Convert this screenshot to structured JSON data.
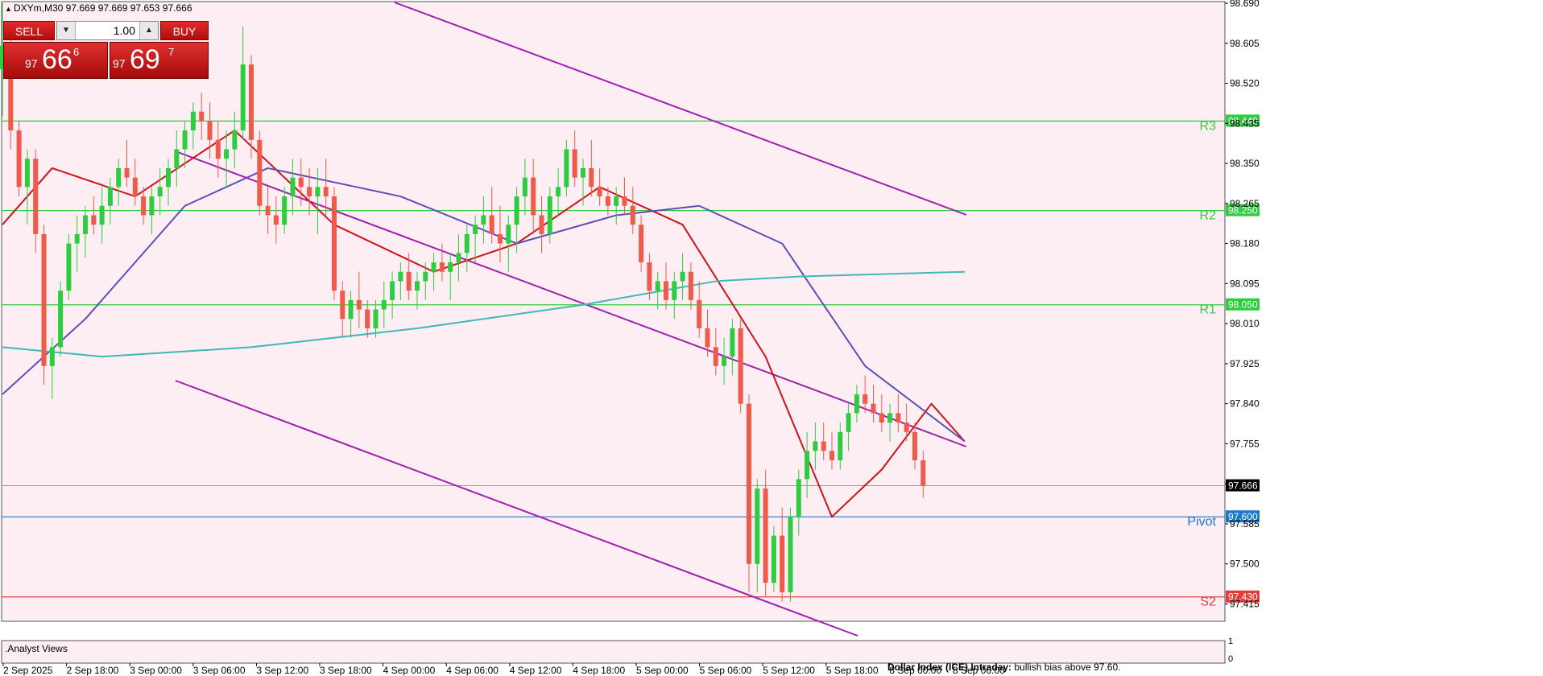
{
  "header": {
    "symbol_line": "DXYm,M30  97.669 97.669 97.653 97.666"
  },
  "trade_panel": {
    "sell_label": "SELL",
    "buy_label": "BUY",
    "lot_value": "1.00",
    "sell_price": {
      "prefix": "97",
      "big": "66",
      "sup": "6"
    },
    "buy_price": {
      "prefix": "97",
      "big": "69",
      "sup": "7"
    }
  },
  "indicator_window": {
    "label": ".Analyst Views",
    "scale_top": "1",
    "scale_bottom": "0",
    "note_bold": "Dollar Index (ICE) Intraday:",
    "note_text": " bullish bias above 97.60."
  },
  "chart_data": {
    "type": "candlestick",
    "symbol": "DXYm",
    "timeframe": "M30",
    "ylim": [
      97.38,
      98.69
    ],
    "y_ticks": [
      "98.690",
      "98.605",
      "98.520",
      "98.435",
      "98.350",
      "98.265",
      "98.180",
      "98.095",
      "98.010",
      "97.925",
      "97.840",
      "97.755",
      "97.670",
      "97.585",
      "97.500",
      "97.415"
    ],
    "x_ticks": [
      "2 Sep 2025",
      "2 Sep 18:00",
      "3 Sep 00:00",
      "3 Sep 06:00",
      "3 Sep 12:00",
      "3 Sep 18:00",
      "4 Sep 00:00",
      "4 Sep 06:00",
      "4 Sep 12:00",
      "4 Sep 18:00",
      "5 Sep 00:00",
      "5 Sep 06:00",
      "5 Sep 12:00",
      "5 Sep 18:00",
      "8 Sep 00:00",
      "8 Sep 06:00"
    ],
    "current_price": 97.666,
    "current_price_label": "97.666",
    "levels": [
      {
        "name": "R3",
        "value": 98.44,
        "label": "98.440",
        "color": "#2ecc40"
      },
      {
        "name": "R2",
        "value": 98.25,
        "label": "98.250",
        "color": "#2ecc40"
      },
      {
        "name": "R1",
        "value": 98.05,
        "label": "98.050",
        "color": "#2ecc40"
      },
      {
        "name": "Pivot",
        "value": 97.6,
        "label": "97.600",
        "color": "#1e78c8"
      },
      {
        "name": "S2",
        "value": 97.43,
        "label": "97.430",
        "color": "#e03c3c"
      }
    ],
    "candles": [
      [
        98.55,
        98.69,
        98.45,
        98.6
      ],
      [
        98.6,
        98.62,
        98.38,
        98.42
      ],
      [
        98.42,
        98.44,
        98.28,
        98.3
      ],
      [
        98.3,
        98.38,
        98.22,
        98.36
      ],
      [
        98.36,
        98.38,
        98.16,
        98.2
      ],
      [
        98.2,
        98.22,
        97.88,
        97.92
      ],
      [
        97.92,
        97.98,
        97.85,
        97.96
      ],
      [
        97.96,
        98.1,
        97.94,
        98.08
      ],
      [
        98.08,
        98.2,
        98.06,
        98.18
      ],
      [
        98.18,
        98.24,
        98.12,
        98.2
      ],
      [
        98.2,
        98.26,
        98.15,
        98.24
      ],
      [
        98.24,
        98.28,
        98.2,
        98.22
      ],
      [
        98.22,
        98.3,
        98.18,
        98.26
      ],
      [
        98.26,
        98.32,
        98.22,
        98.3
      ],
      [
        98.3,
        98.36,
        98.26,
        98.34
      ],
      [
        98.34,
        98.4,
        98.3,
        98.32
      ],
      [
        98.32,
        98.36,
        98.26,
        98.28
      ],
      [
        98.28,
        98.3,
        98.22,
        98.24
      ],
      [
        98.24,
        98.3,
        98.2,
        98.28
      ],
      [
        98.28,
        98.34,
        98.24,
        98.3
      ],
      [
        98.3,
        98.36,
        98.26,
        98.34
      ],
      [
        98.34,
        98.42,
        98.3,
        98.38
      ],
      [
        98.38,
        98.44,
        98.34,
        98.42
      ],
      [
        98.42,
        98.48,
        98.38,
        98.46
      ],
      [
        98.46,
        98.5,
        98.4,
        98.44
      ],
      [
        98.44,
        98.48,
        98.36,
        98.4
      ],
      [
        98.4,
        98.44,
        98.32,
        98.36
      ],
      [
        98.36,
        98.42,
        98.3,
        98.38
      ],
      [
        98.38,
        98.46,
        98.34,
        98.42
      ],
      [
        98.42,
        98.64,
        98.4,
        98.56
      ],
      [
        98.56,
        98.58,
        98.36,
        98.4
      ],
      [
        98.4,
        98.42,
        98.24,
        98.26
      ],
      [
        98.26,
        98.3,
        98.2,
        98.24
      ],
      [
        98.24,
        98.28,
        98.18,
        98.22
      ],
      [
        98.22,
        98.3,
        98.2,
        98.28
      ],
      [
        98.28,
        98.36,
        98.24,
        98.32
      ],
      [
        98.32,
        98.36,
        98.26,
        98.3
      ],
      [
        98.3,
        98.34,
        98.24,
        98.28
      ],
      [
        98.28,
        98.34,
        98.2,
        98.3
      ],
      [
        98.3,
        98.36,
        98.24,
        98.28
      ],
      [
        98.28,
        98.3,
        98.06,
        98.08
      ],
      [
        98.08,
        98.1,
        97.98,
        98.02
      ],
      [
        98.02,
        98.08,
        97.98,
        98.06
      ],
      [
        98.06,
        98.12,
        98.0,
        98.04
      ],
      [
        98.04,
        98.06,
        97.98,
        98.0
      ],
      [
        98.0,
        98.06,
        97.98,
        98.04
      ],
      [
        98.04,
        98.1,
        98.0,
        98.06
      ],
      [
        98.06,
        98.12,
        98.02,
        98.1
      ],
      [
        98.1,
        98.14,
        98.06,
        98.12
      ],
      [
        98.12,
        98.16,
        98.06,
        98.08
      ],
      [
        98.08,
        98.12,
        98.04,
        98.1
      ],
      [
        98.1,
        98.14,
        98.06,
        98.12
      ],
      [
        98.12,
        98.16,
        98.08,
        98.14
      ],
      [
        98.14,
        98.18,
        98.1,
        98.12
      ],
      [
        98.12,
        98.16,
        98.06,
        98.14
      ],
      [
        98.14,
        98.2,
        98.1,
        98.16
      ],
      [
        98.16,
        98.22,
        98.12,
        98.2
      ],
      [
        98.2,
        98.24,
        98.14,
        98.22
      ],
      [
        98.22,
        98.28,
        98.18,
        98.24
      ],
      [
        98.24,
        98.3,
        98.18,
        98.2
      ],
      [
        98.2,
        98.26,
        98.14,
        98.18
      ],
      [
        98.18,
        98.24,
        98.12,
        98.22
      ],
      [
        98.22,
        98.3,
        98.16,
        98.28
      ],
      [
        98.28,
        98.36,
        98.24,
        98.32
      ],
      [
        98.32,
        98.36,
        98.2,
        98.24
      ],
      [
        98.24,
        98.28,
        98.16,
        98.2
      ],
      [
        98.2,
        98.3,
        98.18,
        98.28
      ],
      [
        98.28,
        98.34,
        98.24,
        98.3
      ],
      [
        98.3,
        98.4,
        98.28,
        98.38
      ],
      [
        98.38,
        98.42,
        98.3,
        98.32
      ],
      [
        98.32,
        98.36,
        98.26,
        98.34
      ],
      [
        98.34,
        98.4,
        98.28,
        98.3
      ],
      [
        98.3,
        98.34,
        98.26,
        98.28
      ],
      [
        98.28,
        98.3,
        98.24,
        98.26
      ],
      [
        98.26,
        98.3,
        98.22,
        98.28
      ],
      [
        98.28,
        98.32,
        98.24,
        98.26
      ],
      [
        98.26,
        98.3,
        98.2,
        98.22
      ],
      [
        98.22,
        98.24,
        98.12,
        98.14
      ],
      [
        98.14,
        98.16,
        98.06,
        98.08
      ],
      [
        98.08,
        98.12,
        98.04,
        98.1
      ],
      [
        98.1,
        98.14,
        98.04,
        98.06
      ],
      [
        98.06,
        98.12,
        98.02,
        98.1
      ],
      [
        98.1,
        98.16,
        98.06,
        98.12
      ],
      [
        98.12,
        98.14,
        98.04,
        98.06
      ],
      [
        98.06,
        98.1,
        97.98,
        98.0
      ],
      [
        98.0,
        98.04,
        97.94,
        97.96
      ],
      [
        97.96,
        98.0,
        97.9,
        97.92
      ],
      [
        97.92,
        97.98,
        97.88,
        97.94
      ],
      [
        97.94,
        98.02,
        97.9,
        98.0
      ],
      [
        98.0,
        98.02,
        97.82,
        97.84
      ],
      [
        97.84,
        97.86,
        97.44,
        97.5
      ],
      [
        97.5,
        97.68,
        97.44,
        97.66
      ],
      [
        97.66,
        97.7,
        97.43,
        97.46
      ],
      [
        97.46,
        97.58,
        97.44,
        97.56
      ],
      [
        97.56,
        97.62,
        97.42,
        97.44
      ],
      [
        97.44,
        97.62,
        97.42,
        97.6
      ],
      [
        97.6,
        97.7,
        97.56,
        97.68
      ],
      [
        97.68,
        97.78,
        97.64,
        97.74
      ],
      [
        97.74,
        97.8,
        97.7,
        97.76
      ],
      [
        97.76,
        97.8,
        97.72,
        97.74
      ],
      [
        97.74,
        97.78,
        97.7,
        97.72
      ],
      [
        97.72,
        97.8,
        97.7,
        97.78
      ],
      [
        97.78,
        97.84,
        97.74,
        97.82
      ],
      [
        97.82,
        97.88,
        97.8,
        97.86
      ],
      [
        97.86,
        97.9,
        97.82,
        97.84
      ],
      [
        97.84,
        97.88,
        97.8,
        97.82
      ],
      [
        97.82,
        97.86,
        97.78,
        97.8
      ],
      [
        97.8,
        97.84,
        97.76,
        97.82
      ],
      [
        97.82,
        97.86,
        97.78,
        97.8
      ],
      [
        97.8,
        97.84,
        97.76,
        97.78
      ],
      [
        97.78,
        97.8,
        97.7,
        97.72
      ],
      [
        97.72,
        97.74,
        97.64,
        97.666
      ]
    ],
    "moving_averages": [
      {
        "name": "MA-fast",
        "color": "#d0121b",
        "points": [
          [
            0,
            98.22
          ],
          [
            6,
            98.34
          ],
          [
            16,
            98.28
          ],
          [
            28,
            98.42
          ],
          [
            40,
            98.22
          ],
          [
            52,
            98.12
          ],
          [
            62,
            98.18
          ],
          [
            72,
            98.3
          ],
          [
            82,
            98.22
          ],
          [
            92,
            97.94
          ],
          [
            100,
            97.6
          ],
          [
            106,
            97.7
          ],
          [
            112,
            97.84
          ],
          [
            116,
            97.76
          ]
        ]
      },
      {
        "name": "MA-slow",
        "color": "#5b50b8",
        "points": [
          [
            0,
            97.86
          ],
          [
            10,
            98.02
          ],
          [
            22,
            98.26
          ],
          [
            32,
            98.34
          ],
          [
            48,
            98.28
          ],
          [
            62,
            98.18
          ],
          [
            74,
            98.24
          ],
          [
            84,
            98.26
          ],
          [
            94,
            98.18
          ],
          [
            104,
            97.92
          ],
          [
            116,
            97.76
          ]
        ]
      },
      {
        "name": "MA-long",
        "color": "#3fb8b8",
        "points": [
          [
            0,
            97.96
          ],
          [
            12,
            97.94
          ],
          [
            30,
            97.96
          ],
          [
            50,
            98.0
          ],
          [
            70,
            98.05
          ],
          [
            86,
            98.1
          ],
          [
            96,
            98.11
          ],
          [
            116,
            98.12
          ]
        ]
      }
    ]
  }
}
